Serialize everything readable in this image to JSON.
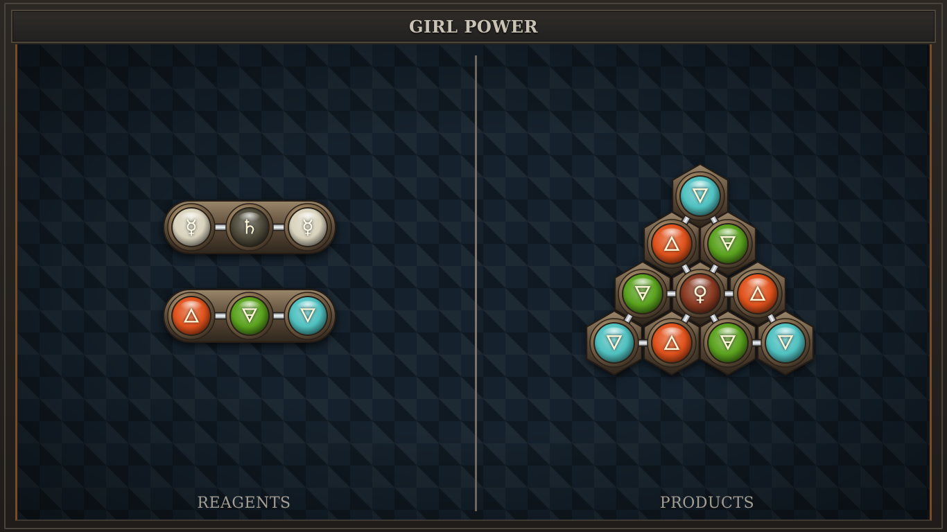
{
  "title": "GIRL POWER",
  "panels": {
    "reagents_label": "REAGENTS",
    "products_label": "PRODUCTS"
  },
  "reagents": [
    {
      "atoms": [
        {
          "element": "quicksilver",
          "symbol": "☿",
          "color": "#d9d3bd"
        },
        {
          "element": "lead",
          "symbol": "♄",
          "color": "#4d4a3a"
        },
        {
          "element": "quicksilver",
          "symbol": "☿",
          "color": "#d9d3bd"
        }
      ]
    },
    {
      "atoms": [
        {
          "element": "fire",
          "symbol": "🜂",
          "color": "#e0521c"
        },
        {
          "element": "earth",
          "symbol": "🜃",
          "color": "#5aa21e"
        },
        {
          "element": "water",
          "symbol": "🜄",
          "color": "#4fc1c0"
        }
      ]
    }
  ],
  "product": {
    "atoms": [
      {
        "element": "water",
        "symbol": "🜄",
        "color": "#4fc1c0"
      },
      {
        "element": "fire",
        "symbol": "🜂",
        "color": "#e0521c"
      },
      {
        "element": "earth",
        "symbol": "🜃",
        "color": "#5aa21e"
      },
      {
        "element": "earth",
        "symbol": "🜃",
        "color": "#5aa21e"
      },
      {
        "element": "copper",
        "symbol": "♀",
        "color": "#8a3a22"
      },
      {
        "element": "fire",
        "symbol": "🜂",
        "color": "#e0521c"
      },
      {
        "element": "water",
        "symbol": "🜄",
        "color": "#4fc1c0"
      },
      {
        "element": "fire",
        "symbol": "🜂",
        "color": "#e0521c"
      },
      {
        "element": "earth",
        "symbol": "🜃",
        "color": "#5aa21e"
      },
      {
        "element": "water",
        "symbol": "🜄",
        "color": "#4fc1c0"
      }
    ]
  },
  "colors": {
    "board_bg": "#15212c",
    "frame_rim": "#7a4a24",
    "metal": "#a08a6a"
  }
}
